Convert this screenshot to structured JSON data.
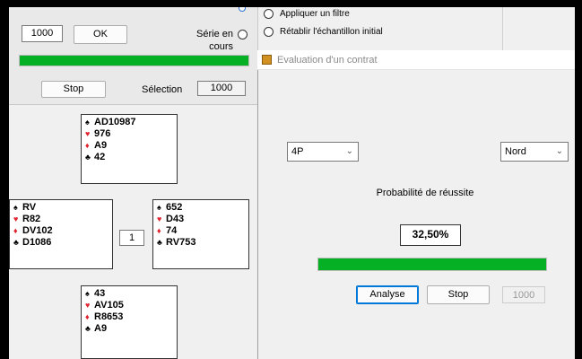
{
  "left": {
    "count_value": "1000",
    "ok_label": "OK",
    "series_label": "Série en cours",
    "progress": 1.0,
    "stop_label": "Stop",
    "selection_label": "Sélection",
    "selection_value": "1000",
    "center_number": "1"
  },
  "hands": {
    "north": [
      "AD10987",
      "976",
      "A9",
      "42"
    ],
    "west": [
      "RV",
      "R82",
      "DV102",
      "D1086"
    ],
    "east": [
      "652",
      "D43",
      "74",
      "RV753"
    ],
    "south": [
      "43",
      "AV105",
      "R8653",
      "A9"
    ]
  },
  "suits": [
    {
      "symbol": "♠",
      "color": "#000000"
    },
    {
      "symbol": "♥",
      "color": "#e0202a"
    },
    {
      "symbol": "♦",
      "color": "#e0202a"
    },
    {
      "symbol": "♣",
      "color": "#000000"
    }
  ],
  "strip": {
    "option1": "Appliquer un filtre",
    "option2": "Rétablir l'échantillon initial"
  },
  "dialog": {
    "title": "Evaluation d'un contrat",
    "contract_value": "4P",
    "declarer_value": "Nord",
    "probability_label": "Probabilité de réussite",
    "probability_value": "32,50%",
    "progress": 1.0,
    "analyse_label": "Analyse",
    "stop_label": "Stop",
    "count_value": "1000"
  }
}
